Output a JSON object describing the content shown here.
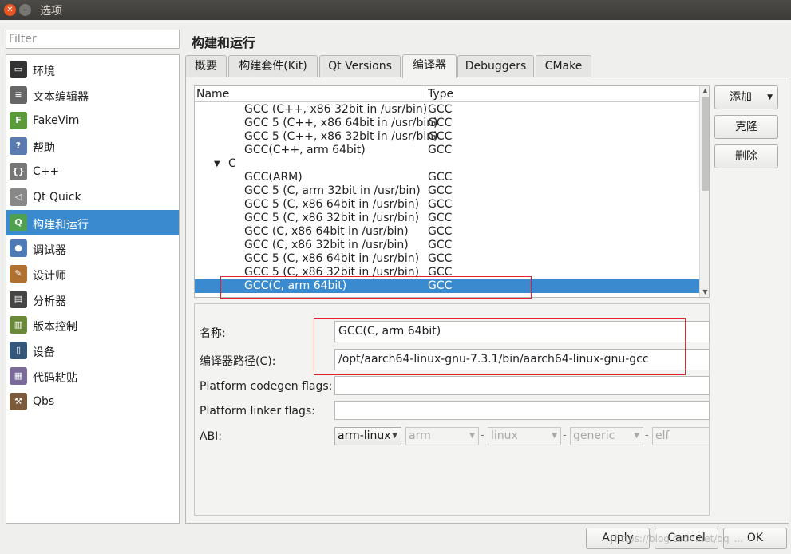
{
  "window": {
    "title": "选项"
  },
  "filter": {
    "placeholder": "Filter"
  },
  "sidebar": {
    "items": [
      {
        "label": "环境",
        "icon": "monitor-icon"
      },
      {
        "label": "文本编辑器",
        "icon": "text-editor-icon"
      },
      {
        "label": "FakeVim",
        "icon": "fakevim-icon"
      },
      {
        "label": "帮助",
        "icon": "help-icon"
      },
      {
        "label": "C++",
        "icon": "cpp-braces-icon"
      },
      {
        "label": "Qt Quick",
        "icon": "qtquick-icon"
      },
      {
        "label": "构建和运行",
        "icon": "build-run-icon",
        "selected": true
      },
      {
        "label": "调试器",
        "icon": "debugger-icon"
      },
      {
        "label": "设计师",
        "icon": "designer-icon"
      },
      {
        "label": "分析器",
        "icon": "analyzer-icon"
      },
      {
        "label": "版本控制",
        "icon": "version-control-icon"
      },
      {
        "label": "设备",
        "icon": "device-icon"
      },
      {
        "label": "代码粘贴",
        "icon": "code-paste-icon"
      },
      {
        "label": "Qbs",
        "icon": "qbs-hammer-icon"
      }
    ]
  },
  "page_title": "构建和运行",
  "tabs": [
    "概要",
    "构建套件(Kit)",
    "Qt Versions",
    "编译器",
    "Debuggers",
    "CMake"
  ],
  "active_tab": "编译器",
  "tree": {
    "headers": [
      "Name",
      "Type"
    ],
    "rows": [
      {
        "name": "GCC (C++, x86 32bit in /usr/bin)",
        "type": "GCC"
      },
      {
        "name": "GCC 5 (C++, x86 64bit in /usr/bin)",
        "type": "GCC"
      },
      {
        "name": "GCC 5 (C++, x86 32bit in /usr/bin)",
        "type": "GCC"
      },
      {
        "name": "GCC(C++, arm 64bit)",
        "type": "GCC"
      },
      {
        "name": "C",
        "type": "",
        "group": true
      },
      {
        "name": "GCC(ARM)",
        "type": "GCC"
      },
      {
        "name": "GCC 5 (C, arm 32bit in /usr/bin)",
        "type": "GCC"
      },
      {
        "name": "GCC 5 (C, x86 64bit in /usr/bin)",
        "type": "GCC"
      },
      {
        "name": "GCC 5 (C, x86 32bit in /usr/bin)",
        "type": "GCC"
      },
      {
        "name": "GCC (C, x86 64bit in /usr/bin)",
        "type": "GCC"
      },
      {
        "name": "GCC (C, x86 32bit in /usr/bin)",
        "type": "GCC"
      },
      {
        "name": "GCC 5 (C, x86 64bit in /usr/bin)",
        "type": "GCC"
      },
      {
        "name": "GCC 5 (C, x86 32bit in /usr/bin)",
        "type": "GCC"
      },
      {
        "name": "GCC(C, arm 64bit)",
        "type": "GCC",
        "selected": true
      }
    ]
  },
  "buttons": {
    "add": "添加",
    "clone": "克隆",
    "remove": "删除",
    "apply": "Apply",
    "cancel": "Cancel",
    "ok": "OK"
  },
  "details": {
    "name_label": "名称:",
    "name_value": "GCC(C, arm 64bit)",
    "path_label": "编译器路径(C):",
    "path_value": "/opt/aarch64-linux-gnu-7.3.1/bin/aarch64-linux-gnu-gcc",
    "codegen_label": "Platform codegen flags:",
    "codegen_value": "",
    "linker_label": "Platform linker flags:",
    "linker_value": "",
    "abi_label": "ABI:",
    "abi": [
      "arm-linux",
      "arm",
      "linux",
      "generic",
      "elf"
    ]
  },
  "watermark": "https://blog.csdn.net/qq_..."
}
